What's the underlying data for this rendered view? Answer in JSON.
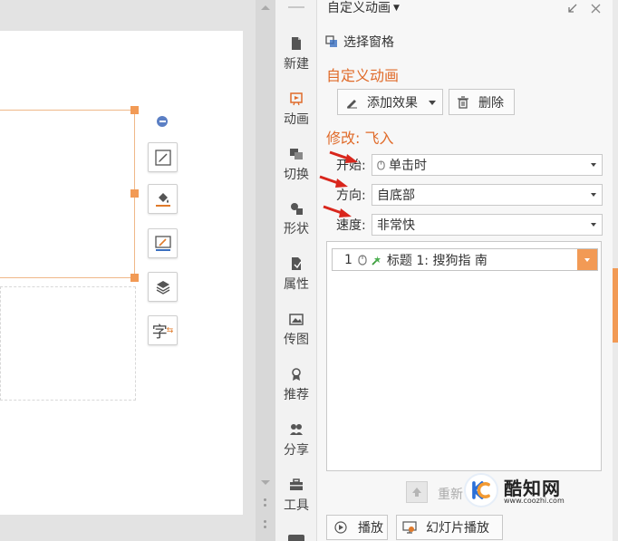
{
  "pane": {
    "title": "自定义动画",
    "select_pane": "选择窗格",
    "section_custom": "自定义动画",
    "add_effect": "添加效果",
    "delete": "删除",
    "modify_label": "修改: 飞入",
    "start_label": "开始:",
    "start_value": "单击时",
    "direction_label": "方向:",
    "direction_value": "自底部",
    "speed_label": "速度:",
    "speed_value": "非常快",
    "anim_item": {
      "index": "1",
      "text": "标题 1: 搜狗指 南"
    },
    "reorder_label": "重新",
    "play": "播放",
    "slideshow": "幻灯片播放"
  },
  "sidebar": {
    "items": [
      {
        "label": "新建",
        "icon": "new-file-icon"
      },
      {
        "label": "动画",
        "icon": "animation-icon"
      },
      {
        "label": "切换",
        "icon": "transition-icon"
      },
      {
        "label": "形状",
        "icon": "shapes-icon"
      },
      {
        "label": "属性",
        "icon": "properties-icon"
      },
      {
        "label": "传图",
        "icon": "upload-image-icon"
      },
      {
        "label": "推荐",
        "icon": "recommend-icon"
      },
      {
        "label": "分享",
        "icon": "share-icon"
      },
      {
        "label": "工具",
        "icon": "toolbox-icon"
      }
    ]
  },
  "float_tools": [
    {
      "icon": "edit-shape-icon"
    },
    {
      "icon": "fill-bucket-icon"
    },
    {
      "icon": "outline-pen-icon"
    },
    {
      "icon": "layers-icon"
    },
    {
      "icon": "text-style-icon",
      "glyph": "字"
    }
  ],
  "watermark": {
    "name": "酷知网",
    "url": "www.coozhi.com"
  },
  "colors": {
    "accent": "#e06b2a",
    "handle": "#f29a55",
    "arrow": "#d9261c"
  }
}
